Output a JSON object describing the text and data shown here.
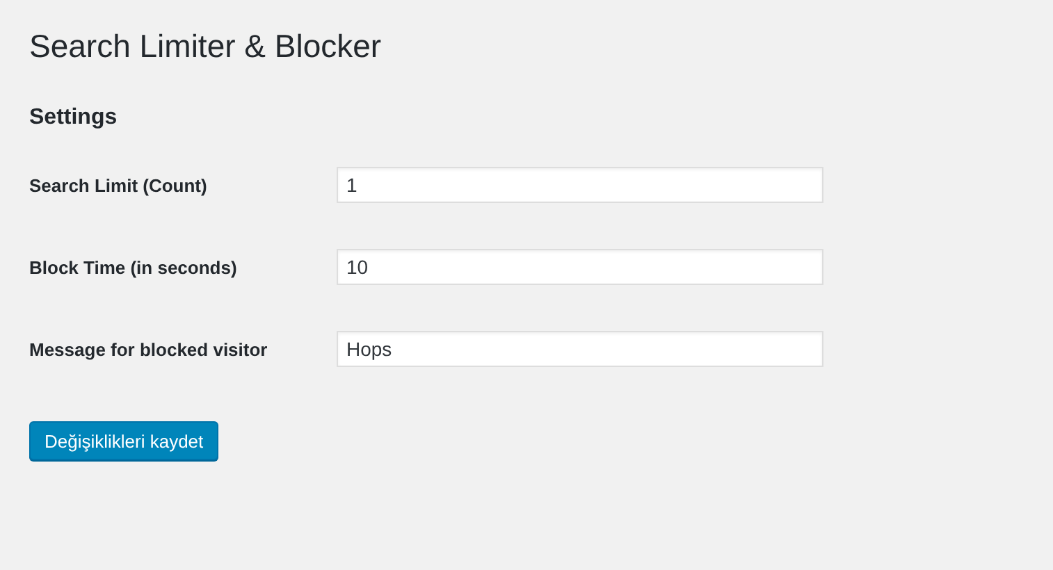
{
  "page_title": "Search Limiter & Blocker",
  "section_title": "Settings",
  "fields": [
    {
      "label": "Search Limit (Count)",
      "value": "1"
    },
    {
      "label": "Block Time (in seconds)",
      "value": "10"
    },
    {
      "label": "Message for blocked visitor",
      "value": "Hops"
    }
  ],
  "submit_button": "Değişiklikleri kaydet"
}
